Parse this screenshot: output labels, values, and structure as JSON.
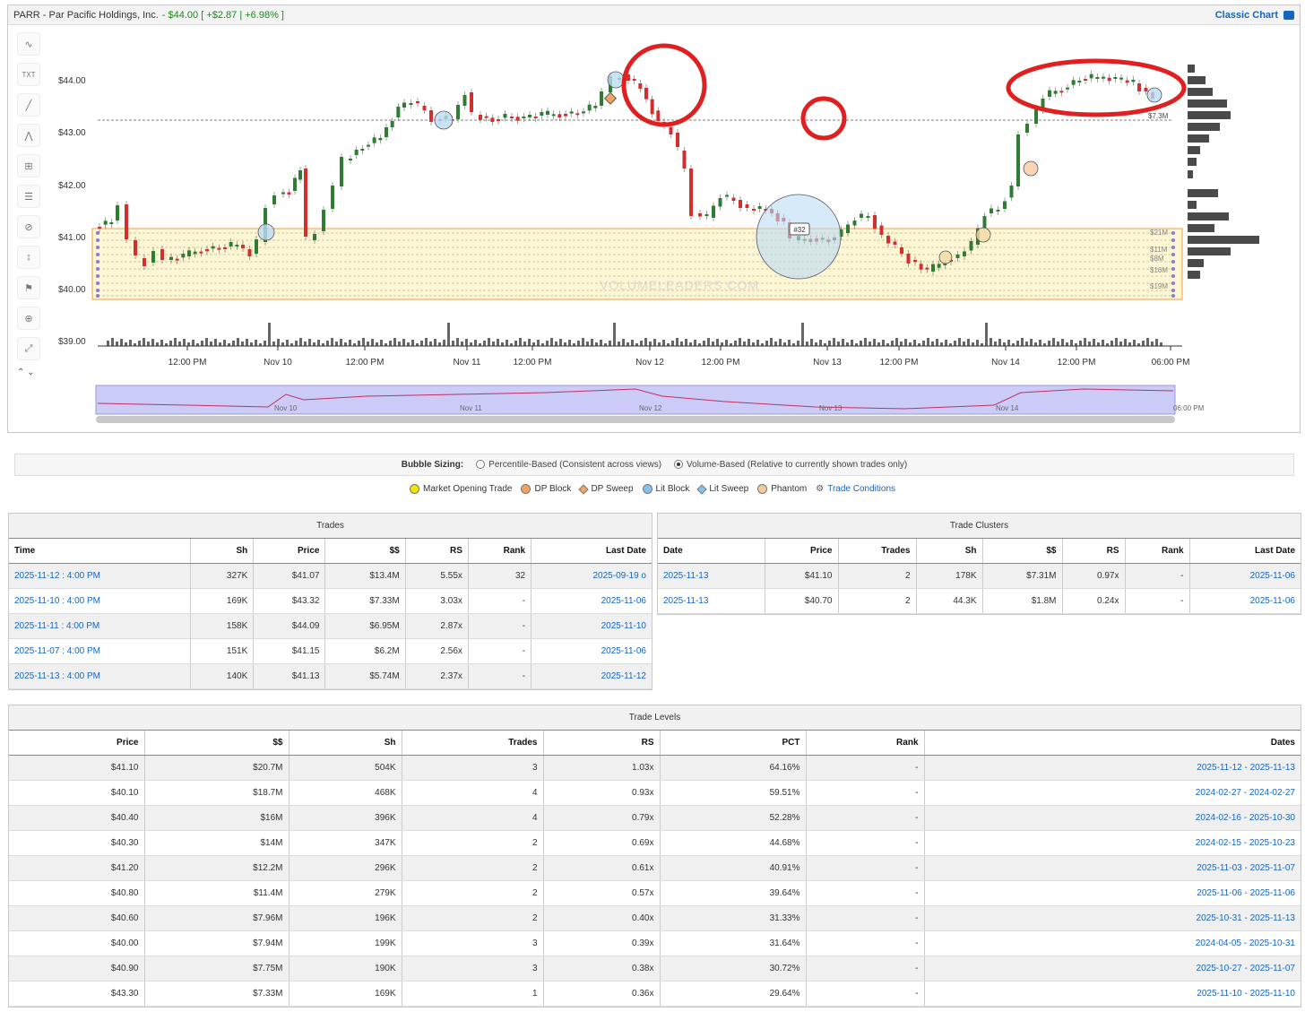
{
  "header": {
    "title": "PARR - Par Pacific Holdings, Inc.",
    "price_change": "- $44.00 [ +$2.87 | +6.98% ]",
    "classic_chart": "Classic Chart"
  },
  "chart": {
    "y_ticks": [
      "$44.00",
      "$43.00",
      "$42.00",
      "$41.00",
      "$40.00",
      "$39.00"
    ],
    "x_ticks": [
      "12:00 PM",
      "Nov 10",
      "12:00 PM",
      "Nov 11",
      "12:00 PM",
      "Nov 12",
      "12:00 PM",
      "Nov 13",
      "12:00 PM",
      "Nov 14",
      "12:00 PM",
      "06:00 PM"
    ],
    "nav_labels": [
      "Nov 10",
      "Nov 11",
      "Nov 12",
      "Nov 13",
      "Nov 14",
      "06:00 PM"
    ],
    "level_labels": [
      "$21M",
      "$11M",
      "$8M",
      "$16M",
      "$19M"
    ],
    "dashed_level_label": "$7.3M",
    "bubble_label": "#32",
    "watermark": "VOLUMELEADERS.COM",
    "colors": {
      "up": "#2e7d32",
      "down": "#d32f2f",
      "zone": "#fdf6d3",
      "zone_border": "#f0a040",
      "annotation": "#e02020"
    }
  },
  "bubble_sizing": {
    "label": "Bubble Sizing:",
    "options": [
      "Percentile-Based (Consistent across views)",
      "Volume-Based (Relative to currently shown trades only)"
    ],
    "selected": 1
  },
  "legend": {
    "items": [
      {
        "label": "Market Opening Trade",
        "color": "#f5e400",
        "shape": "dot"
      },
      {
        "label": "DP Block",
        "color": "#f4a460",
        "shape": "dot"
      },
      {
        "label": "DP Sweep",
        "color": "#f4a460",
        "shape": "diamond"
      },
      {
        "label": "Lit Block",
        "color": "#87c3f0",
        "shape": "dot"
      },
      {
        "label": "Lit Sweep",
        "color": "#87c3f0",
        "shape": "diamond"
      },
      {
        "label": "Phantom",
        "color": "#f8c79a",
        "shape": "dot"
      }
    ],
    "trade_conditions": "Trade Conditions"
  },
  "trades": {
    "title": "Trades",
    "columns": [
      "Time",
      "Sh",
      "Price",
      "$$",
      "RS",
      "Rank",
      "Last Date"
    ],
    "rows": [
      [
        "2025-11-12 : 4:00 PM",
        "327K",
        "$41.07",
        "$13.4M",
        "5.55x",
        "32",
        "2025-09-19 o"
      ],
      [
        "2025-11-10 : 4:00 PM",
        "169K",
        "$43.32",
        "$7.33M",
        "3.03x",
        "-",
        "2025-11-06"
      ],
      [
        "2025-11-11 : 4:00 PM",
        "158K",
        "$44.09",
        "$6.95M",
        "2.87x",
        "-",
        "2025-11-10"
      ],
      [
        "2025-11-07 : 4:00 PM",
        "151K",
        "$41.15",
        "$6.2M",
        "2.56x",
        "-",
        "2025-11-06"
      ],
      [
        "2025-11-13 : 4:00 PM",
        "140K",
        "$41.13",
        "$5.74M",
        "2.37x",
        "-",
        "2025-11-12"
      ]
    ]
  },
  "clusters": {
    "title": "Trade Clusters",
    "columns": [
      "Date",
      "Price",
      "Trades",
      "Sh",
      "$$",
      "RS",
      "Rank",
      "Last Date"
    ],
    "rows": [
      [
        "2025-11-13",
        "$41.10",
        "2",
        "178K",
        "$7.31M",
        "0.97x",
        "-",
        "2025-11-06"
      ],
      [
        "2025-11-13",
        "$40.70",
        "2",
        "44.3K",
        "$1.8M",
        "0.24x",
        "-",
        "2025-11-06"
      ]
    ]
  },
  "levels": {
    "title": "Trade Levels",
    "columns": [
      "Price",
      "$$",
      "Sh",
      "Trades",
      "RS",
      "PCT",
      "Rank",
      "Dates"
    ],
    "rows": [
      [
        "$41.10",
        "$20.7M",
        "504K",
        "3",
        "1.03x",
        "64.16%",
        "-",
        "2025-11-12 - 2025-11-13"
      ],
      [
        "$40.10",
        "$18.7M",
        "468K",
        "4",
        "0.93x",
        "59.51%",
        "-",
        "2024-02-27 - 2024-02-27"
      ],
      [
        "$40.40",
        "$16M",
        "396K",
        "4",
        "0.79x",
        "52.28%",
        "-",
        "2024-02-16 - 2025-10-30"
      ],
      [
        "$40.30",
        "$14M",
        "347K",
        "2",
        "0.69x",
        "44.68%",
        "-",
        "2024-02-15 - 2025-10-23"
      ],
      [
        "$41.20",
        "$12.2M",
        "296K",
        "2",
        "0.61x",
        "40.91%",
        "-",
        "2025-11-03 - 2025-11-07"
      ],
      [
        "$40.80",
        "$11.4M",
        "279K",
        "2",
        "0.57x",
        "39.64%",
        "-",
        "2025-11-06 - 2025-11-06"
      ],
      [
        "$40.60",
        "$7.96M",
        "196K",
        "2",
        "0.40x",
        "31.33%",
        "-",
        "2025-10-31 - 2025-11-13"
      ],
      [
        "$40.00",
        "$7.94M",
        "199K",
        "3",
        "0.39x",
        "31.64%",
        "-",
        "2024-04-05 - 2025-10-31"
      ],
      [
        "$40.90",
        "$7.75M",
        "190K",
        "3",
        "0.38x",
        "30.72%",
        "-",
        "2025-10-27 - 2025-11-07"
      ],
      [
        "$43.30",
        "$7.33M",
        "169K",
        "1",
        "0.36x",
        "29.64%",
        "-",
        "2025-11-10 - 2025-11-10"
      ]
    ]
  }
}
